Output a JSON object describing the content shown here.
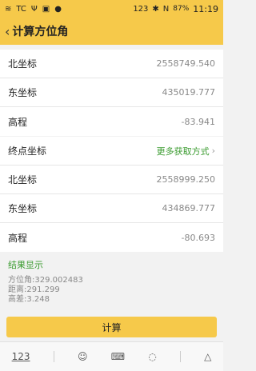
{
  "status": {
    "icons_left": [
      "≋",
      "TC",
      "Ψ",
      "▣",
      "●"
    ],
    "icons_right": [
      "123",
      "✱",
      "N"
    ],
    "battery": "87%",
    "time": "11:19"
  },
  "header": {
    "title": "计算方位角"
  },
  "start_point": {
    "rows": [
      {
        "label": "北坐标",
        "value": "2558749.540"
      },
      {
        "label": "东坐标",
        "value": "435019.777"
      },
      {
        "label": "高程",
        "value": "-83.941"
      }
    ]
  },
  "end_point": {
    "label": "终点坐标",
    "more_link": "更多获取方式",
    "rows": [
      {
        "label": "北坐标",
        "value": "2558999.250"
      },
      {
        "label": "东坐标",
        "value": "434869.777"
      },
      {
        "label": "高程",
        "value": "-80.693"
      }
    ]
  },
  "result": {
    "title": "结果显示",
    "lines": [
      "方位角:329.002483",
      "距离:291.299",
      "高差:3.248"
    ]
  },
  "calc_button": "计算",
  "keyboard_bar": [
    "123",
    "☺",
    "⌨",
    "◌",
    "△"
  ]
}
